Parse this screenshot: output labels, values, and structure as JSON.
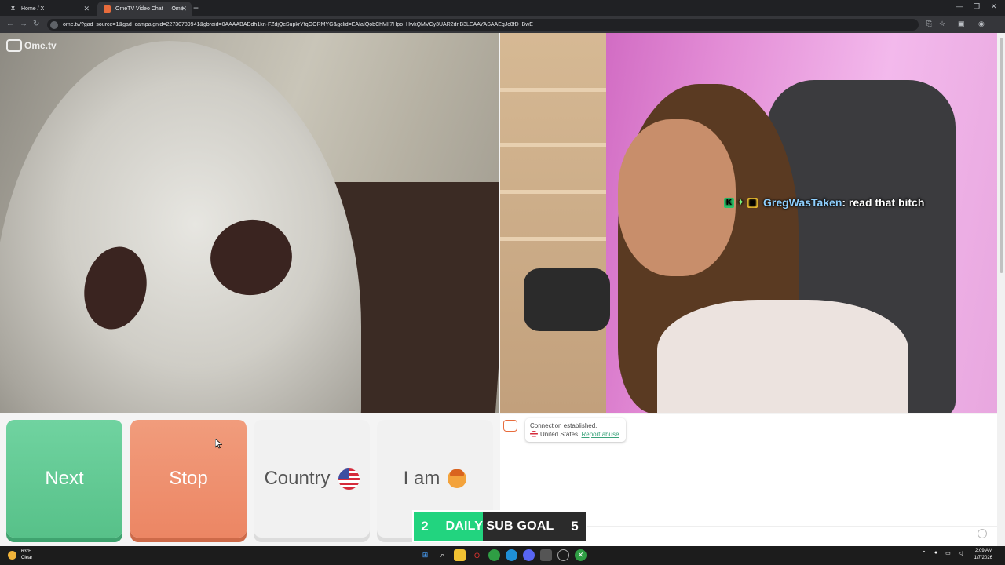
{
  "browser": {
    "tabs": [
      {
        "label": "Home / X",
        "icon": "x-logo-icon"
      },
      {
        "label": "OmeTV Video Chat — Ome",
        "icon": "ometv-icon",
        "active": true
      }
    ],
    "url": "ome.tv/?gad_source=1&gad_campaignid=22730789941&gbraid=0AAAABADdh1kn-FZdjQcSupkrYfqGORMYG&gclid=EAIaIQobChMIl7Hpo_HwkQMVCy3UAR2dnB3LEAAYASAAEgJc8fD_BwE"
  },
  "app": {
    "logo_text": "Ome.tv",
    "logo_box": "Ome TV"
  },
  "overlay": {
    "chat_user": "GregWasTaken",
    "chat_message": " : read that bitch",
    "badges": [
      "K",
      "✦",
      "▣"
    ]
  },
  "controls": {
    "next_label": "Next",
    "stop_label": "Stop",
    "country_label": "Country",
    "iam_label": "I am"
  },
  "chat": {
    "connection": "Connection established.",
    "country": "United States.",
    "report_label": "Report abuse",
    "report_suffix": ".",
    "icon_text": "Ome TV"
  },
  "sub_goal": {
    "current": "2",
    "label": "DAILY SUB GOAL",
    "target": "5",
    "progress": 0.4
  },
  "taskbar": {
    "temperature": "63°F",
    "condition": "Clear",
    "time": "2:09 AM",
    "date": "1/7/2026"
  },
  "colors": {
    "next": "#5bc58e",
    "stop": "#ee8b69",
    "subgoal_fill": "#22d47f",
    "chat_username": "#8fd0ff"
  }
}
